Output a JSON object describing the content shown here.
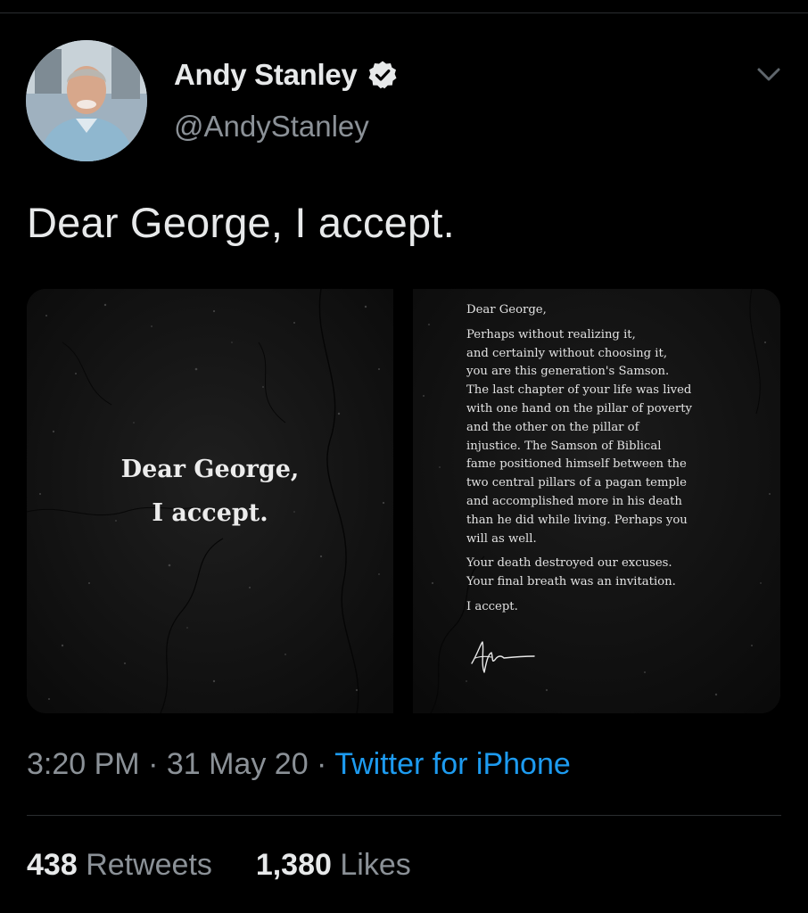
{
  "author": {
    "name": "Andy Stanley",
    "handle": "@AndyStanley",
    "verified": true,
    "avatar_icon": "avatar-photo"
  },
  "tweet": {
    "text": "Dear George, I accept."
  },
  "media": {
    "left_image": {
      "lines": [
        "Dear George,",
        "I accept."
      ]
    },
    "right_image": {
      "salutation": "Dear George,",
      "paragraph1": [
        "Perhaps without realizing it,",
        "and certainly without choosing it,",
        "you are this generation's Samson.",
        "The last chapter of your life was lived",
        "with one hand on the pillar of poverty",
        "and the other on the pillar of",
        "injustice. The Samson of Biblical",
        "fame positioned himself between the",
        "two central pillars of a pagan temple",
        "and accomplished more in his death",
        "than he did while living. Perhaps you",
        "will as well."
      ],
      "paragraph2": [
        "Your death destroyed our excuses.",
        "Your final breath was an invitation."
      ],
      "signoff": "I accept."
    }
  },
  "meta": {
    "time": "3:20 PM",
    "separator": " · ",
    "date": "31 May 20",
    "source": "Twitter for iPhone"
  },
  "stats": {
    "retweets_count": "438",
    "retweets_label": "Retweets",
    "likes_count": "1,380",
    "likes_label": "Likes"
  },
  "colors": {
    "background": "#000000",
    "primary_text": "#e7e9ea",
    "secondary_text": "#8b9197",
    "link": "#1d9bf0",
    "divider": "#2a2d30"
  }
}
